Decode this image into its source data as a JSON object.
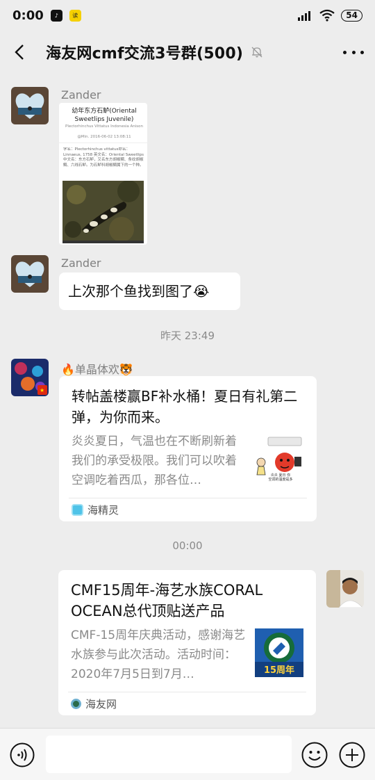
{
  "status_bar": {
    "time": "0:00",
    "battery": "54"
  },
  "header": {
    "title": "海友网cmf交流3号群(500)"
  },
  "messages": [
    {
      "sender": "Zander",
      "image_card": {
        "title": "幼年东方石鲈(Oriental Sweetlips Juvenile)",
        "subtitle": "Plectorhinchus Vittatus Indonesia Anison",
        "meta": "@Min.    2016-06-02 13:08:11",
        "body": "学名：Plectorhinchus vittatus命名：Linnaeus, 1758 英文名：Oriental Sweetlips 中文名：东方石鲈，又名东方胡椒鲷、条纹胡椒鲷、六线石鲈。为石鲈科胡椒鲷属下的一个种。"
      }
    },
    {
      "sender": "Zander",
      "text": "上次那个鱼找到图了😭"
    },
    {
      "timestamp": "昨天 23:49"
    },
    {
      "sender": "🔥单晶体欢🐯",
      "link": {
        "title": "转帖盖楼赢BF补水桶！夏日有礼第二弹，为你而来。",
        "desc": "炎炎夏日，气温也在不断刷新着我们的承受极限。我们可以吹着空调吃着西瓜，那各位…",
        "thumb_caption": "炎炎 夏日 你\n空调的温度是多",
        "source": "海精灵"
      }
    },
    {
      "timestamp": "00:00"
    },
    {
      "link": {
        "title": "CMF15周年-海艺水族CORAL OCEAN总代顶贴送产品",
        "desc": "CMF-15周年庆典活动，感谢海艺水族参与此次活动。活动时间：2020年7月5日到7月…",
        "thumb_caption": "15周年",
        "source": "海友网"
      }
    }
  ],
  "input": {
    "placeholder": ""
  }
}
